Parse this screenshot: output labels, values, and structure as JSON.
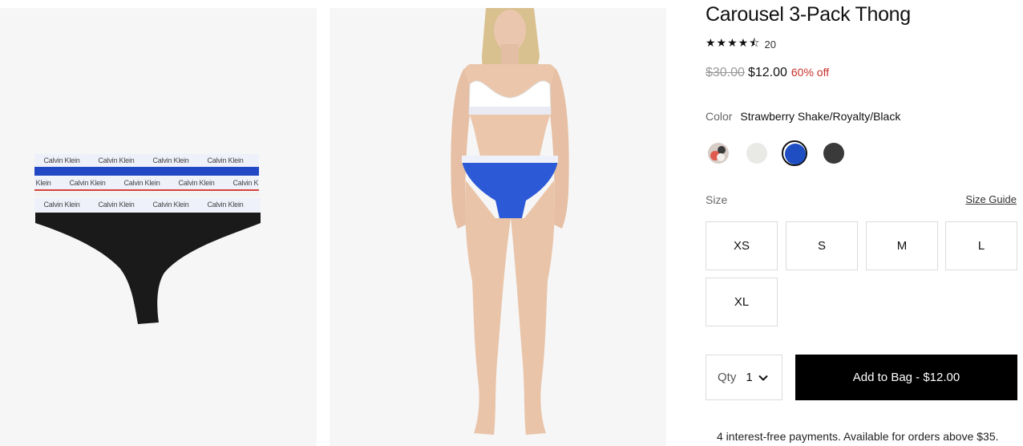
{
  "product": {
    "title": "Carousel 3-Pack Thong",
    "rating_count": "20",
    "stars": "★★★★⯪"
  },
  "price": {
    "original": "$30.00",
    "sale": "$12.00",
    "discount": "60% off"
  },
  "color": {
    "label": "Color",
    "selected_name": "Strawberry Shake/Royalty/Black",
    "swatches": [
      {
        "name": "Strawberry Shake",
        "color": "#d4c7c1"
      },
      {
        "name": "White",
        "color": "#e8e8e6"
      },
      {
        "name": "Royalty",
        "color": "#1f4ec2"
      },
      {
        "name": "Black",
        "color": "#3a3a3a"
      }
    ]
  },
  "size": {
    "label": "Size",
    "guide_label": "Size Guide",
    "options": [
      "XS",
      "S",
      "M",
      "L",
      "XL"
    ]
  },
  "qty": {
    "label": "Qty",
    "value": "1"
  },
  "cart": {
    "add_label": "Add to Bag  -  $12.00"
  },
  "installments_text": "4 interest-free payments. Available for orders above $35.",
  "images": {
    "waistband_text": "Calvin Klein"
  }
}
